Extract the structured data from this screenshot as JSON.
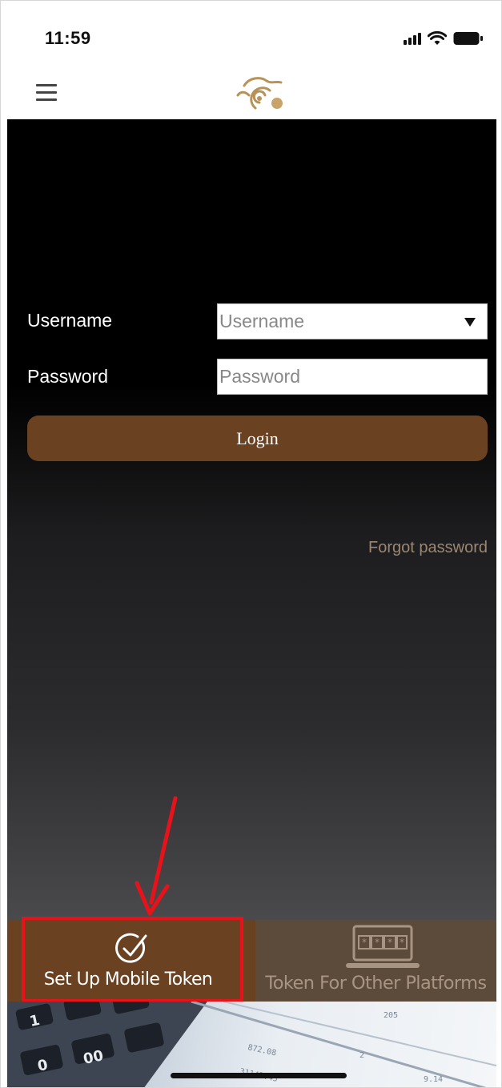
{
  "status_bar": {
    "time": "11:59"
  },
  "header": {
    "menu_icon": "hamburger-menu-icon",
    "logo_icon": "dragon-logo-icon"
  },
  "login_form": {
    "username_label": "Username",
    "username_placeholder": "Username",
    "username_value": "",
    "password_label": "Password",
    "password_placeholder": "Password",
    "password_value": "",
    "login_label": "Login",
    "forgot_password_label": "Forgot password"
  },
  "tab_bar": {
    "tabs": [
      {
        "label": "Set Up Mobile Token",
        "icon": "check-circle-icon",
        "selected": true
      },
      {
        "label": "Token For Other Platforms",
        "icon": "laptop-icon",
        "selected": false
      }
    ]
  },
  "colors": {
    "brand_brown": "#6a4222",
    "highlight_red": "#e8121a",
    "link_tan": "#9c8770"
  }
}
